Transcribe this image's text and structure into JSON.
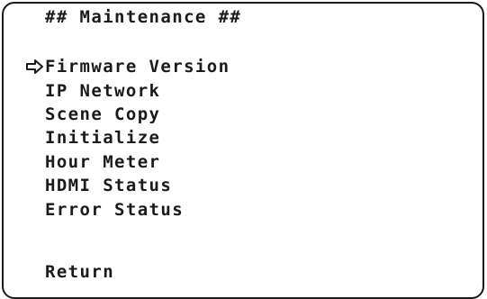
{
  "menu": {
    "title": "## Maintenance ##",
    "items": [
      {
        "label": "Firmware Version",
        "selected": true
      },
      {
        "label": "IP Network",
        "selected": false
      },
      {
        "label": "Scene Copy",
        "selected": false
      },
      {
        "label": "Initialize",
        "selected": false
      },
      {
        "label": "Hour Meter",
        "selected": false
      },
      {
        "label": "HDMI Status",
        "selected": false
      },
      {
        "label": "Error Status",
        "selected": false
      }
    ],
    "return_label": "Return",
    "cursor_icon": "right-arrow-outline-icon",
    "colors": {
      "text": "#1a1a1a",
      "background": "#ffffff"
    }
  }
}
